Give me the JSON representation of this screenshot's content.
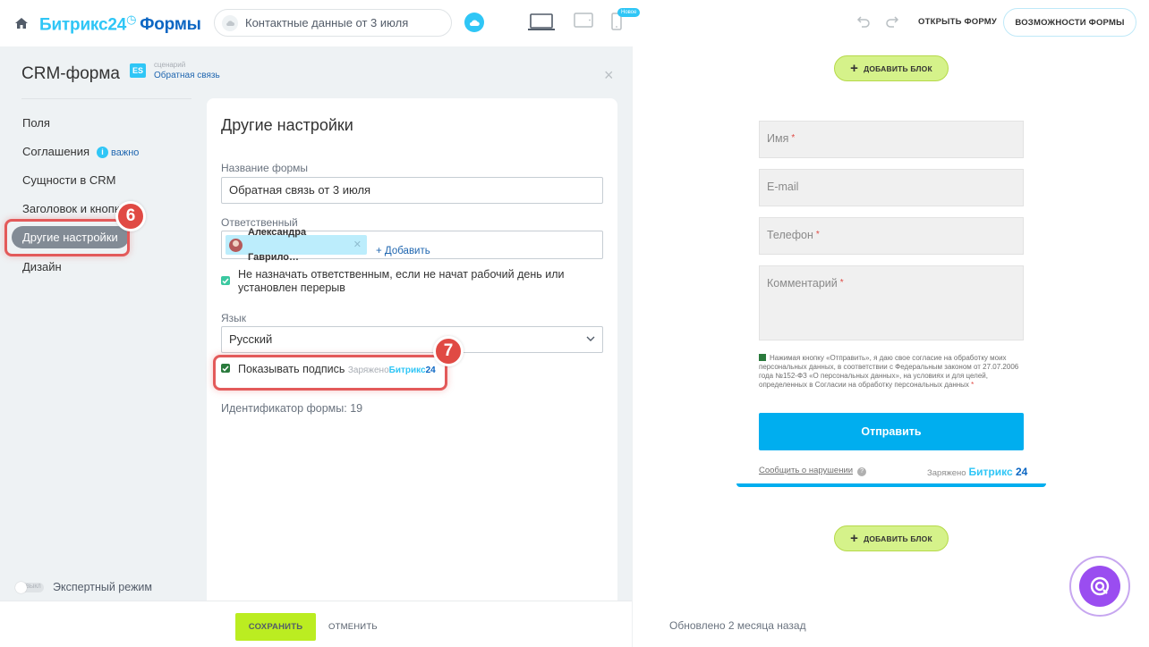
{
  "header": {
    "logo_b24": "Битрикс24",
    "logo_forms": "Формы",
    "form_title": "Контактные данные от 3 июля",
    "new_badge": "Новое",
    "open_form": "ОТКРЫТЬ ФОРМУ",
    "features": "ВОЗМОЖНОСТИ ФОРМЫ"
  },
  "panel": {
    "title": "CRM-форма",
    "scenario_label": "сценарий",
    "scenario_value": "Обратная связь",
    "scenario_icon": "ES",
    "close": "×"
  },
  "nav": {
    "items": [
      {
        "label": "Поля"
      },
      {
        "label": "Соглашения",
        "badge": "важно"
      },
      {
        "label": "Сущности в CRM"
      },
      {
        "label": "Заголовок и кнопка"
      },
      {
        "label": "Другие настройки"
      },
      {
        "label": "Дизайн"
      }
    ],
    "expert_toggle": "ВЫКЛ",
    "expert_label": "Экспертный режим"
  },
  "settings": {
    "title": "Другие настройки",
    "form_name_label": "Название формы",
    "form_name_value": "Обратная связь от 3 июля",
    "responsible_label": "Ответственный",
    "responsible_user": "Александра Гаврило…",
    "add_label": "+ Добавить",
    "no_assign_label": "Не назначать ответственным, если не начат рабочий день или установлен перерыв",
    "language_label": "Язык",
    "language_value": "Русский",
    "show_signature_label": "Показывать подпись",
    "charged_by": "Заряжено",
    "brand_part1": "Битрикс",
    "brand_part2": "24",
    "form_id_label": "Идентификатор формы: 19"
  },
  "steps": {
    "step6": "6",
    "step7": "7"
  },
  "footer": {
    "save": "СОХРАНИТЬ",
    "cancel": "ОТМЕНИТЬ"
  },
  "preview": {
    "add_block": "ДОБАВИТЬ БЛОК",
    "fields": [
      {
        "label": "Имя",
        "required": "*"
      },
      {
        "label": "E-mail",
        "required": ""
      },
      {
        "label": "Телефон",
        "required": "*"
      },
      {
        "label": "Комментарий",
        "required": "*"
      }
    ],
    "consent": "Нажимая кнопку «Отправить», я даю свое согласие на обработку моих персональных данных, в соответствии с Федеральным законом от 27.07.2006 года №152-ФЗ «О персональных данных», на условиях и для целей, определенных в Согласии на обработку персональных данных",
    "consent_required": "*",
    "submit": "Отправить",
    "report": "Сообщить о нарушении",
    "charged_by": "Заряжено",
    "brand_part1": "Битрикс",
    "brand_part2": "24",
    "updated": "Обновлено 2 месяца назад"
  },
  "colors": {
    "accent": "#2fc6f6",
    "save_green": "#bbed21",
    "highlight_red": "#e35a5a",
    "submit_blue": "#00aeef",
    "fab_purple": "#9a4df0"
  }
}
